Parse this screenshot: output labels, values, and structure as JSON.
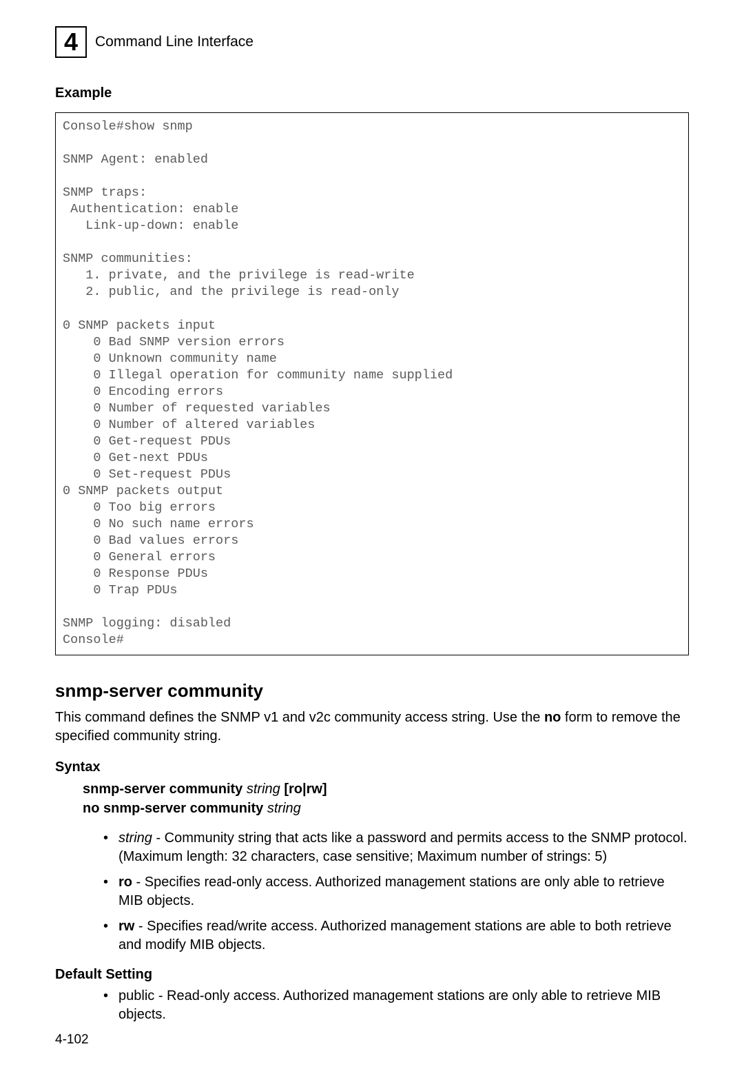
{
  "header": {
    "chapter_number": "4",
    "title": "Command Line Interface"
  },
  "example": {
    "heading": "Example",
    "console": "Console#show snmp\n\nSNMP Agent: enabled\n\nSNMP traps:\n Authentication: enable\n   Link-up-down: enable\n\nSNMP communities:\n   1. private, and the privilege is read-write\n   2. public, and the privilege is read-only\n\n0 SNMP packets input\n    0 Bad SNMP version errors\n    0 Unknown community name\n    0 Illegal operation for community name supplied\n    0 Encoding errors\n    0 Number of requested variables\n    0 Number of altered variables\n    0 Get-request PDUs\n    0 Get-next PDUs\n    0 Set-request PDUs\n0 SNMP packets output\n    0 Too big errors\n    0 No such name errors\n    0 Bad values errors\n    0 General errors\n    0 Response PDUs\n    0 Trap PDUs\n\nSNMP logging: disabled\nConsole#"
  },
  "command": {
    "title": "snmp-server community",
    "description_pre": "This command defines the SNMP v1 and v2c community access string. Use the ",
    "description_bold": "no",
    "description_post": " form to remove the specified community string."
  },
  "syntax": {
    "heading": "Syntax",
    "line1_cmd": "snmp-server community",
    "line1_param": "string",
    "line1_opts": "[ro|rw]",
    "line2_cmd": "no snmp-server community",
    "line2_param": "string",
    "bullets": {
      "b1_term": "string",
      "b1_text": " - Community string that acts like a password and permits access to the SNMP protocol. (Maximum length: 32 characters, case sensitive; Maximum number of strings: 5)",
      "b2_term": "ro",
      "b2_text": " - Specifies read-only access. Authorized management stations are only able to retrieve MIB objects.",
      "b3_term": "rw",
      "b3_text": " - Specifies read/write access. Authorized management stations are able to both retrieve and modify MIB objects."
    }
  },
  "default_setting": {
    "heading": "Default Setting",
    "bullets": {
      "b1": "public - Read-only access. Authorized management stations are only able to retrieve MIB objects."
    }
  },
  "page_number": "4-102"
}
